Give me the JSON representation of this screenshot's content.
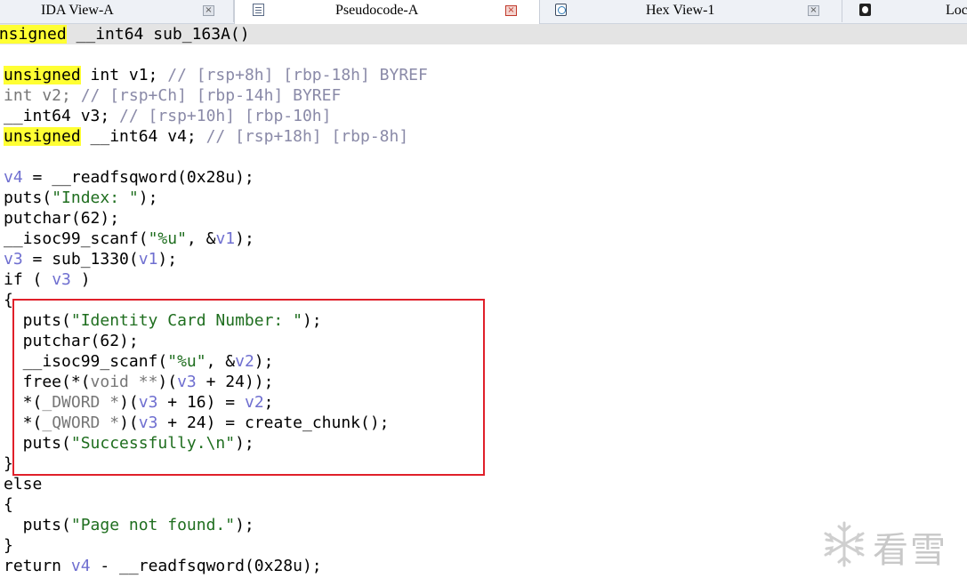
{
  "tabs": [
    {
      "label": "IDA View-A",
      "icon": "ida-view-icon",
      "active": false
    },
    {
      "label": "Pseudocode-A",
      "icon": "pseudocode-icon",
      "active": true
    },
    {
      "label": "Hex View-1",
      "icon": "hex-view-icon",
      "active": false
    },
    {
      "label": "Loc",
      "icon": "local-types-icon",
      "active": false
    }
  ],
  "tab_close_glyph": "×",
  "signature": [
    "unsigned",
    " __int64 sub_163A()"
  ],
  "code": {
    "l1": [
      "unsigned",
      " int v1; ",
      "// [rsp+8h] [rbp-18h] BYREF"
    ],
    "l2": [
      "int v2; ",
      "// [rsp+Ch] [rbp-14h] BYREF"
    ],
    "l3": [
      "__int64 v3; ",
      "// [rsp+10h] [rbp-10h]"
    ],
    "l4": [
      "unsigned",
      " __int64 v4; ",
      "// [rsp+18h] [rbp-8h]"
    ],
    "l5": [
      "v4",
      " = __readfsqword(0x28u);"
    ],
    "l6": [
      "puts(",
      "\"Index: \"",
      ");"
    ],
    "l7": [
      "putchar(62);"
    ],
    "l8": [
      "__isoc99_scanf(",
      "\"%u\"",
      ", &",
      "v1",
      ");"
    ],
    "l9": [
      "v3",
      " = sub_1330(",
      "v1",
      ");"
    ],
    "l10": [
      "if ( ",
      "v3",
      " )"
    ],
    "l11": [
      "{"
    ],
    "l12": [
      "  puts(",
      "\"Identity Card Number: \"",
      ");"
    ],
    "l13": [
      "  putchar(62);"
    ],
    "l14": [
      "  __isoc99_scanf(",
      "\"%u\"",
      ", &",
      "v2",
      ");"
    ],
    "l15": [
      "  free(*(",
      "void **",
      ")(",
      "v3",
      " + 24));"
    ],
    "l16": [
      "  *(",
      "_DWORD *",
      ")(",
      "v3",
      " + 16) = ",
      "v2",
      ";"
    ],
    "l17": [
      "  *(",
      "_QWORD *",
      ")(",
      "v3",
      " + 24) = create_chunk();"
    ],
    "l18": [
      "  puts(",
      "\"Successfully.\\n\"",
      ");"
    ],
    "l19": [
      "}"
    ],
    "l20": [
      "else"
    ],
    "l21": [
      "{"
    ],
    "l22": [
      "  puts(",
      "\"Page not found.\"",
      ");"
    ],
    "l23": [
      "}"
    ],
    "l24": [
      "return ",
      "v4",
      " - __readfsqword(0x28u);"
    ]
  },
  "watermark": {
    "text": "看雪",
    "icon": "snowflake-icon"
  },
  "colors": {
    "highlight": "#ffff33",
    "annotation_box": "#e0202a",
    "string": "#1f6e1f",
    "variable": "#6f6fd0",
    "comment": "#8a8aa8"
  }
}
